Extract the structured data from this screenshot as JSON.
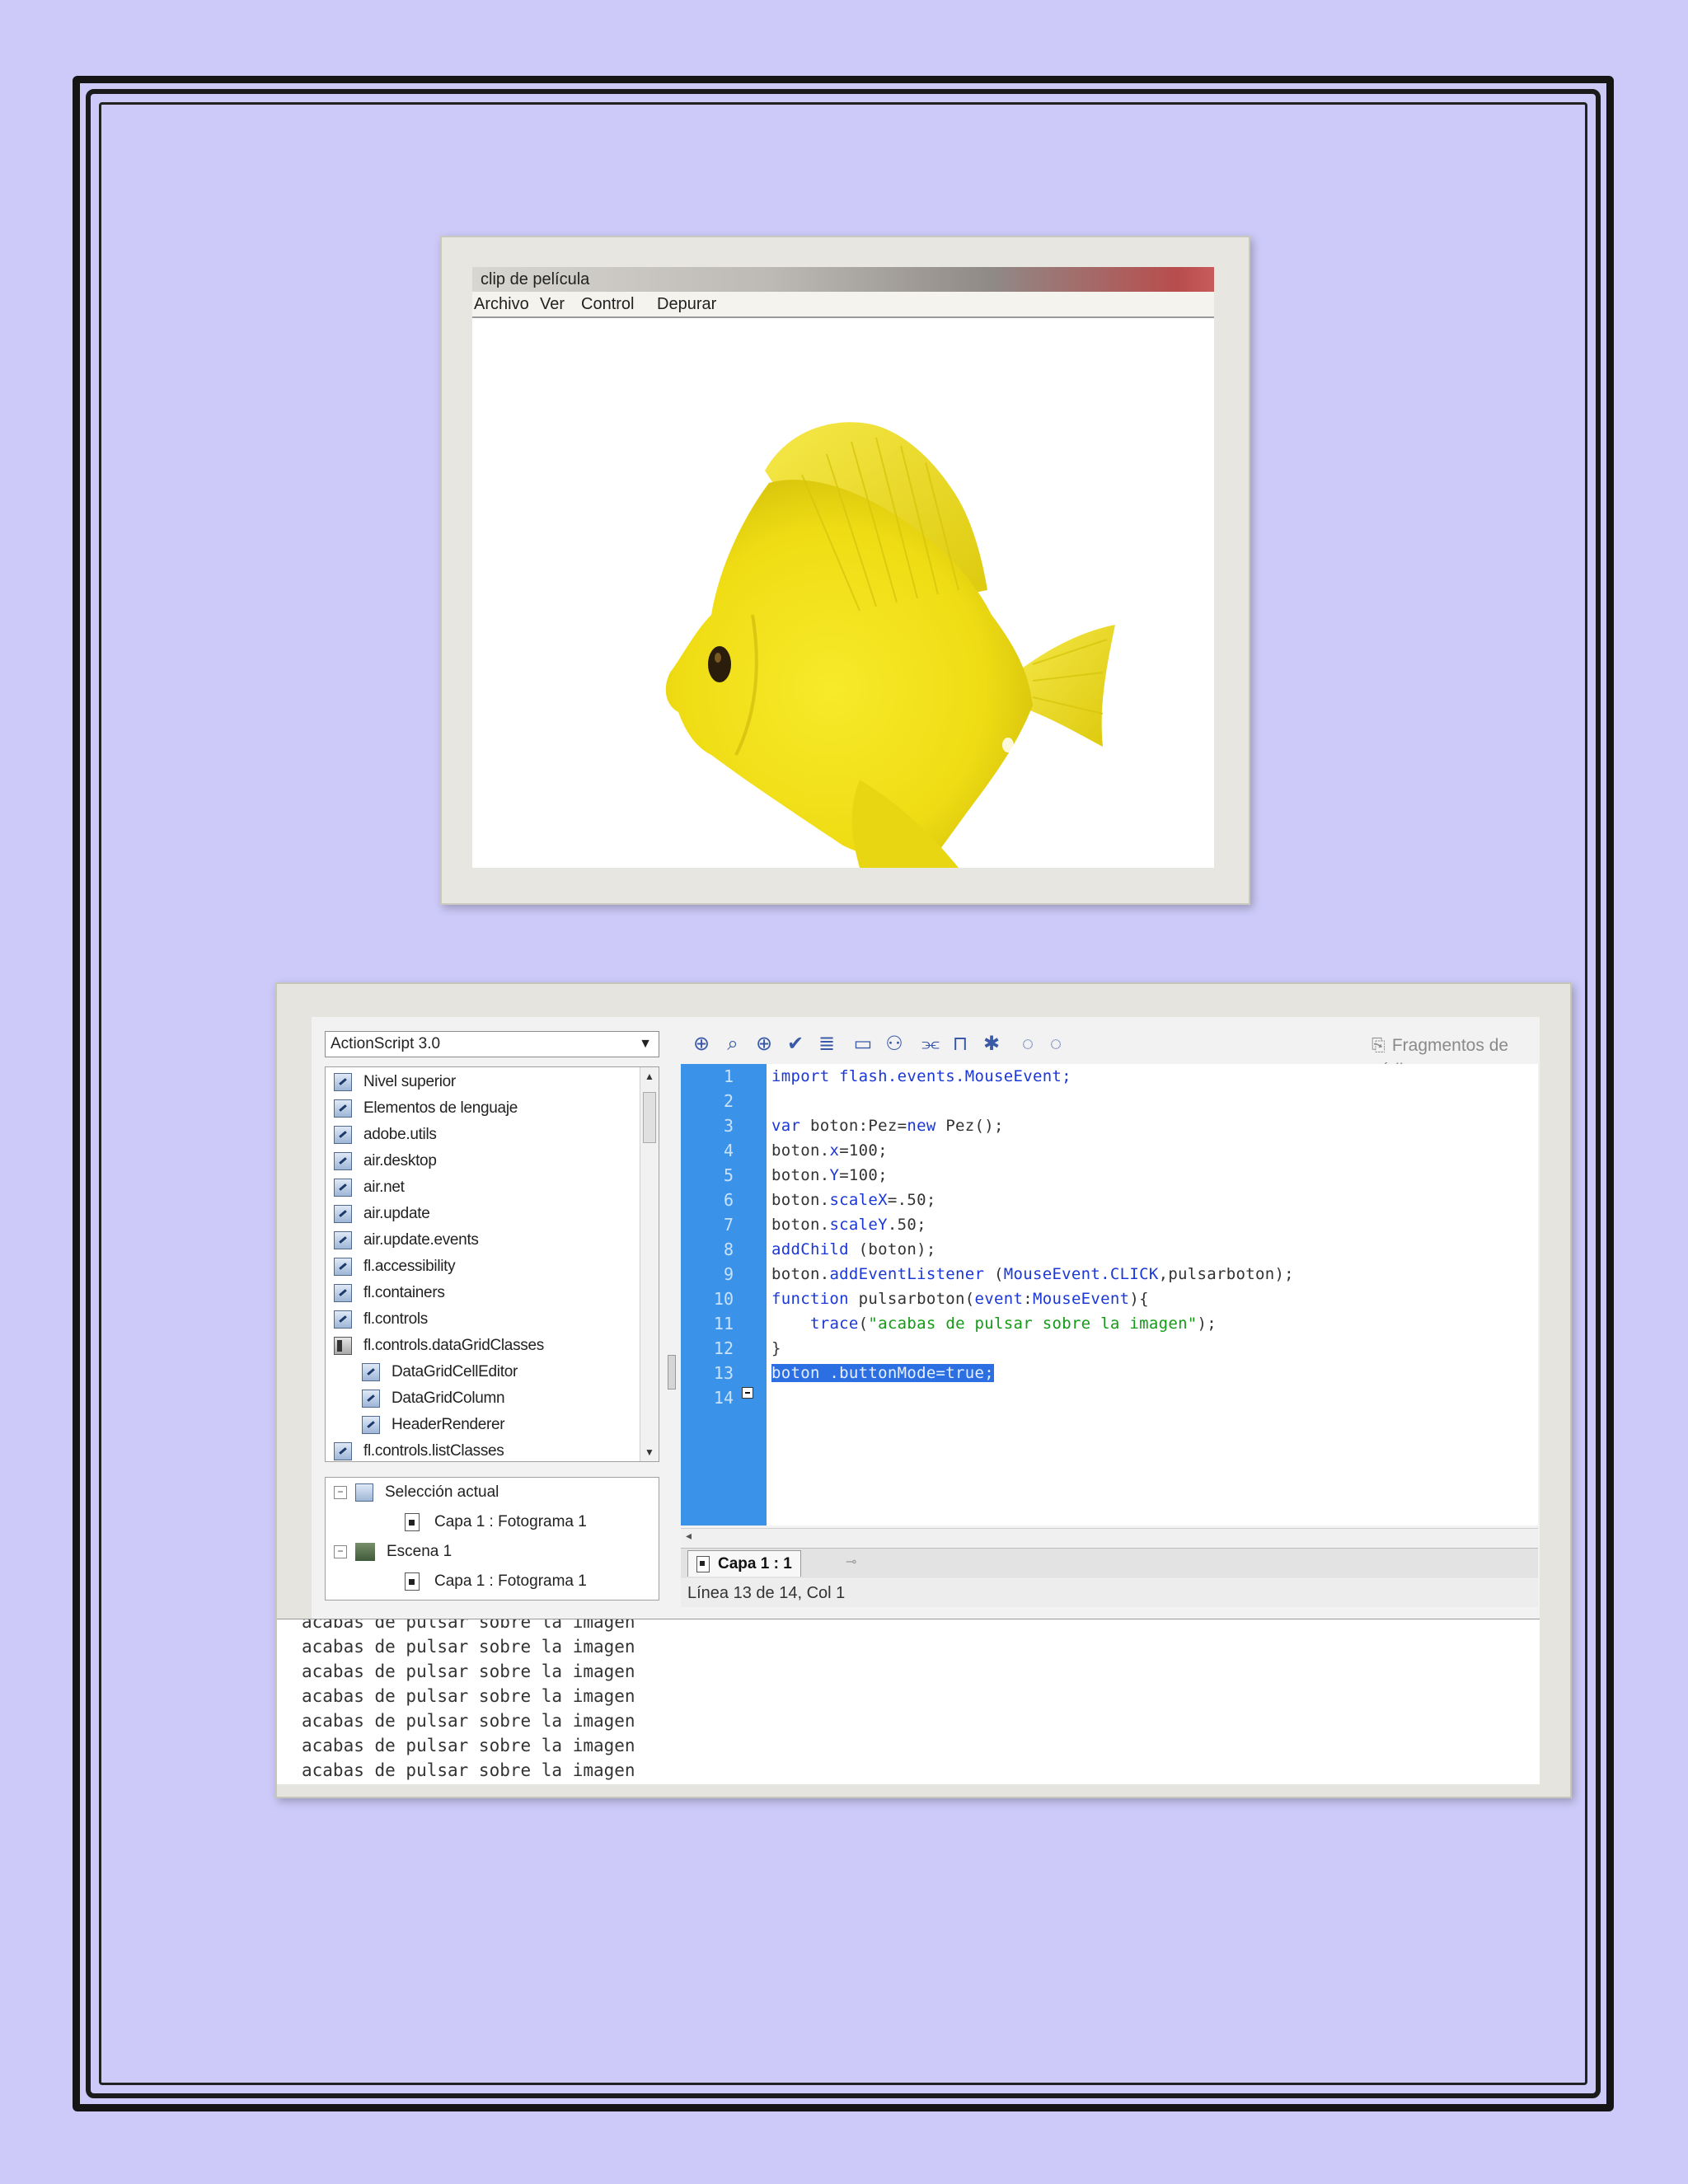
{
  "top_window": {
    "title": "clip de película",
    "menu": [
      "Archivo",
      "Ver",
      "Control",
      "Depurar"
    ],
    "stage_image": "yellow-tang-fish"
  },
  "editor_window": {
    "language_selector": "ActionScript 3.0",
    "library_tree": [
      {
        "label": "Nivel superior",
        "icon": "package-icon",
        "indent": 0
      },
      {
        "label": "Elementos de lenguaje",
        "icon": "package-icon",
        "indent": 0
      },
      {
        "label": "adobe.utils",
        "icon": "package-icon",
        "indent": 0
      },
      {
        "label": "air.desktop",
        "icon": "package-icon",
        "indent": 0
      },
      {
        "label": "air.net",
        "icon": "package-icon",
        "indent": 0
      },
      {
        "label": "air.update",
        "icon": "package-icon",
        "indent": 0
      },
      {
        "label": "air.update.events",
        "icon": "package-icon",
        "indent": 0
      },
      {
        "label": "fl.accessibility",
        "icon": "package-icon",
        "indent": 0
      },
      {
        "label": "fl.containers",
        "icon": "package-icon",
        "indent": 0
      },
      {
        "label": "fl.controls",
        "icon": "package-icon",
        "indent": 0
      },
      {
        "label": "fl.controls.dataGridClasses",
        "icon": "book-icon",
        "indent": 0
      },
      {
        "label": "DataGridCellEditor",
        "icon": "class-icon",
        "indent": 1
      },
      {
        "label": "DataGridColumn",
        "icon": "class-icon",
        "indent": 1
      },
      {
        "label": "HeaderRenderer",
        "icon": "class-icon",
        "indent": 1
      },
      {
        "label": "fl.controls.listClasses",
        "icon": "package-icon",
        "indent": 0
      }
    ],
    "scene_tree": {
      "current_selection": "Selección actual",
      "current_frame": "Capa 1 : Fotograma 1",
      "scene": "Escena 1",
      "scene_frame": "Capa 1 : Fotograma 1"
    },
    "toolbar": {
      "icons": [
        "add-statement-icon",
        "find-icon",
        "target-path-icon",
        "check-syntax-icon",
        "auto-format-icon",
        "code-hint-icon",
        "debug-options-icon",
        "collapse-between-braces-icon",
        "collapse-selection-icon",
        "expand-all-icon",
        "apply-block-comment-icon",
        "apply-line-comment-icon"
      ],
      "fragments_label": "Fragmentos de código"
    },
    "line_numbers": [
      "1",
      "2",
      "3",
      "4",
      "5",
      "6",
      "7",
      "8",
      "9",
      "10",
      "11",
      "12",
      "13",
      "14"
    ],
    "code": {
      "l1": {
        "kw": "import",
        "rest": " flash.events.MouseEvent;"
      },
      "l3": {
        "kw": "var",
        "rest": " boton:Pez=",
        "kw2": "new",
        "rest2": " Pez();"
      },
      "l4": {
        "a": "boton.",
        "kw": "x",
        "b": "=100;"
      },
      "l5": {
        "a": "boton.",
        "kw": "Y",
        "b": "=100;"
      },
      "l6": {
        "a": "boton.",
        "kw": "scaleX",
        "b": "=.50;"
      },
      "l7": {
        "a": "boton.",
        "kw": "scaleY",
        "b": ".50;"
      },
      "l8": {
        "kw": "addChild",
        "b": " (boton);"
      },
      "l9": {
        "a": "boton.",
        "kw": "addEventListener",
        "b": " (",
        "kw2": "MouseEvent.CLICK",
        "c": ",pulsarboton);"
      },
      "l10": {
        "kw": "function",
        "a": " pulsarboton(",
        "kw2": "event",
        "b": ":",
        "kw3": "MouseEvent",
        "c": "){"
      },
      "l11": {
        "indent": "    ",
        "kw": "trace",
        "a": "(",
        "str": "\"acabas de pulsar sobre la imagen\"",
        "b": ");"
      },
      "l12": {
        "text": "}"
      },
      "l13": {
        "text": "boton .buttonMode=true;"
      }
    },
    "tab_label": "Capa 1 : 1",
    "status": "Línea 13 de 14, Col 1",
    "output_lines": [
      "acabas de pulsar sobre la imagen",
      "acabas de pulsar sobre la imagen",
      "acabas de pulsar sobre la imagen",
      "acabas de pulsar sobre la imagen",
      "acabas de pulsar sobre la imagen",
      "acabas de pulsar sobre la imagen"
    ]
  },
  "colors": {
    "page_background": "#cdcaf9",
    "gutter": "#3b93e9",
    "keyword": "#1b37d6",
    "string": "#149a17",
    "selection": "#2b6fe3",
    "fish": "#f2e318"
  }
}
